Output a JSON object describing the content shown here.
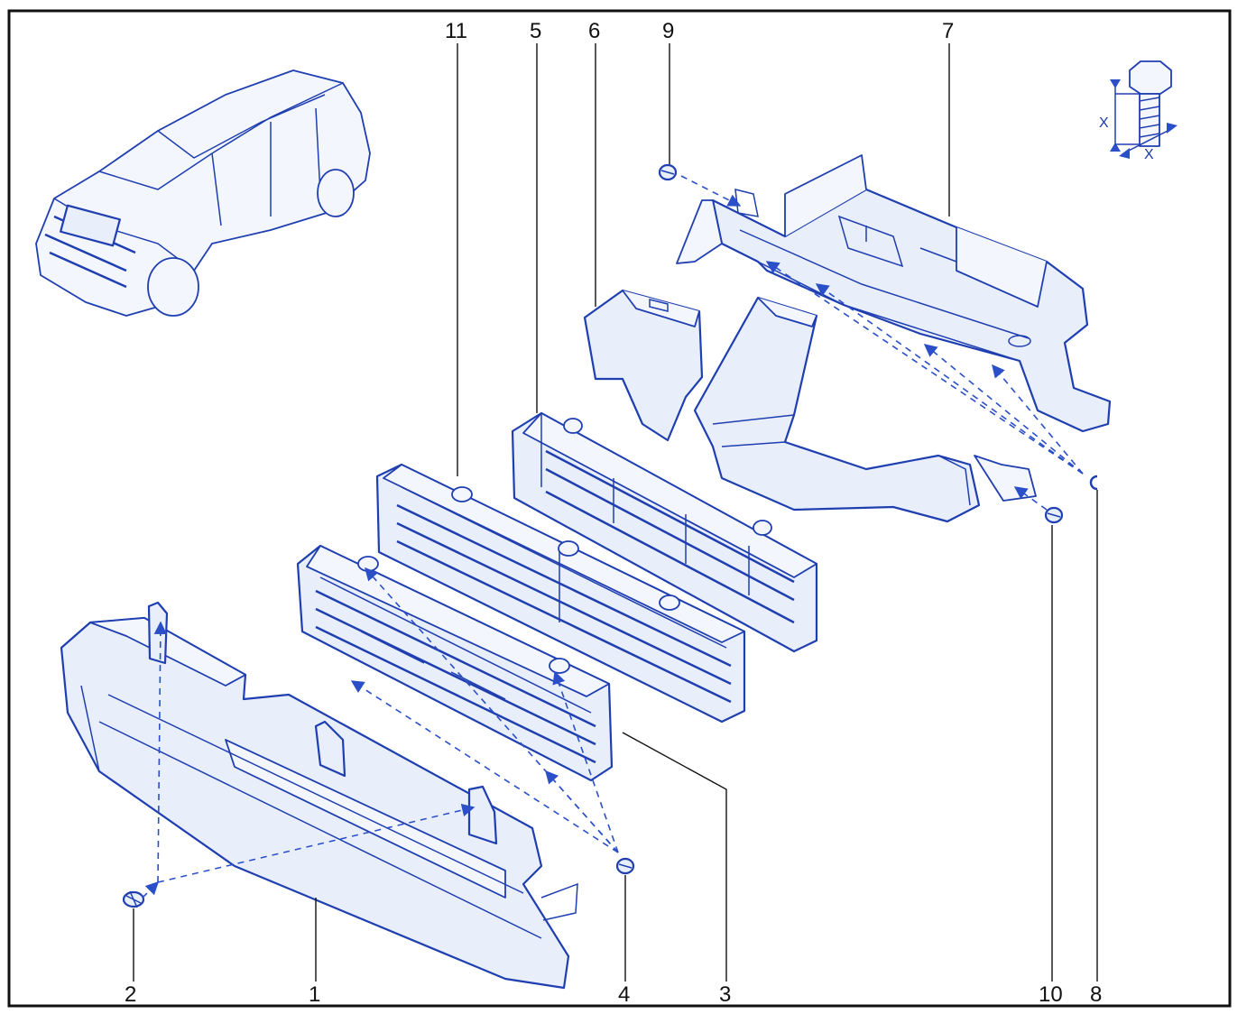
{
  "diagram": {
    "callouts": {
      "c1": "1",
      "c2": "2",
      "c3": "3",
      "c4": "4",
      "c5": "5",
      "c6": "6",
      "c7": "7",
      "c8": "8",
      "c9": "9",
      "c10": "10",
      "c11": "11"
    },
    "dimension_labels": {
      "x_vertical": "X",
      "x_horizontal": "X"
    },
    "colors": {
      "line": "#1f3fb0",
      "fill": "#e9eefb",
      "frame": "#111111"
    },
    "icons": [
      "vehicle-location-icon",
      "screw-dimension-icon"
    ]
  }
}
